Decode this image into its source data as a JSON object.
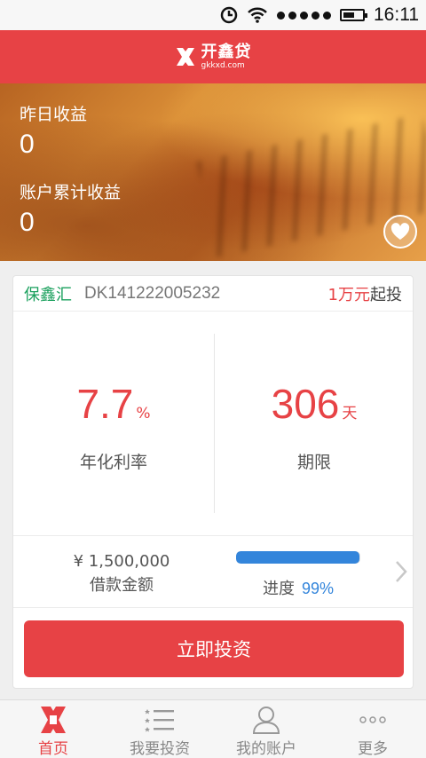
{
  "status_bar": {
    "time": "16:11"
  },
  "header": {
    "logo_cn": "开鑫贷",
    "logo_en": "gkkxd.com"
  },
  "banner": {
    "yesterday_label": "昨日收益",
    "yesterday_value": "0",
    "total_label": "账户累计收益",
    "total_value": "0",
    "favorite_icon": "heart-icon"
  },
  "product": {
    "tag": "保鑫汇",
    "code": "DK141222005232",
    "min_amount": "1万元",
    "min_suffix": "起投",
    "rate_value": "7.7",
    "rate_unit": "%",
    "rate_label": "年化利率",
    "term_value": "306",
    "term_unit": "天",
    "term_label": "期限",
    "loan_amount": "¥ 1,500,000",
    "loan_label": "借款金额",
    "progress_label": "进度",
    "progress_text": "99%",
    "progress_fraction": 0.99,
    "invest_button": "立即投资"
  },
  "tabs": [
    {
      "label": "首页",
      "icon": "home-logo-icon",
      "active": true
    },
    {
      "label": "我要投资",
      "icon": "list-icon",
      "active": false
    },
    {
      "label": "我的账户",
      "icon": "user-icon",
      "active": false
    },
    {
      "label": "更多",
      "icon": "more-dots-icon",
      "active": false
    }
  ],
  "colors": {
    "brand_red": "#e74245",
    "accent_blue": "#3385db",
    "tag_green": "#1aa05d"
  }
}
